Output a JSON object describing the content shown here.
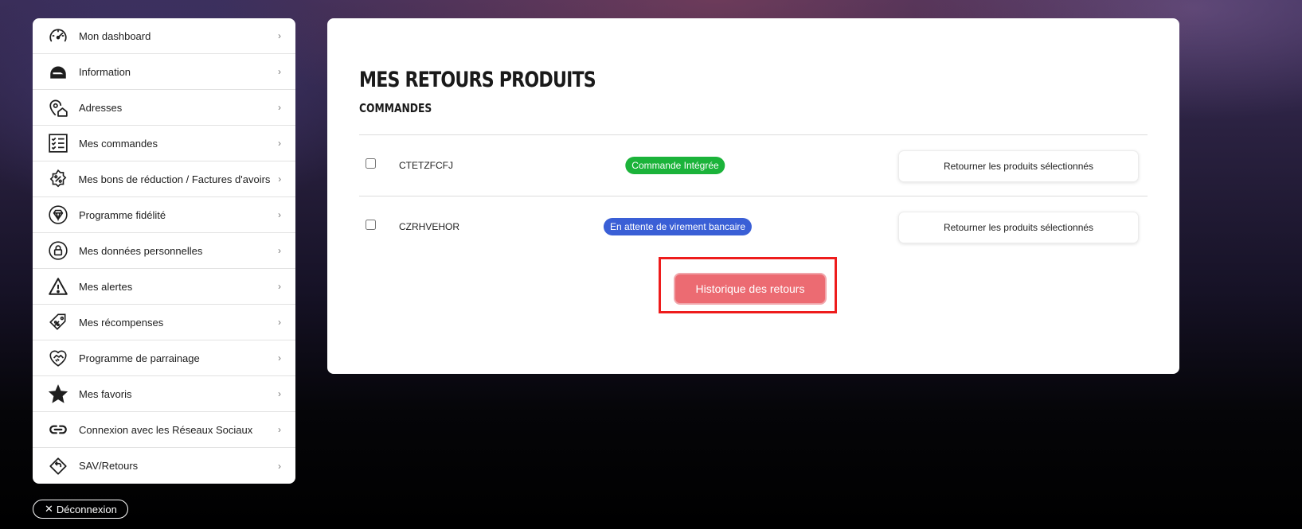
{
  "sidebar": {
    "items": [
      {
        "label": "Mon dashboard",
        "icon": "speedometer-icon"
      },
      {
        "label": "Information",
        "icon": "helmet-icon"
      },
      {
        "label": "Adresses",
        "icon": "location-home-icon"
      },
      {
        "label": "Mes commandes",
        "icon": "checklist-icon"
      },
      {
        "label": "Mes bons de réduction / Factures d'avoirs",
        "icon": "discount-badge-icon"
      },
      {
        "label": "Programme fidélité",
        "icon": "diamond-icon"
      },
      {
        "label": "Mes données personnelles",
        "icon": "lock-icon"
      },
      {
        "label": "Mes alertes",
        "icon": "warning-icon"
      },
      {
        "label": "Mes récompenses",
        "icon": "reward-tag-icon"
      },
      {
        "label": "Programme de parrainage",
        "icon": "handshake-heart-icon"
      },
      {
        "label": "Mes favoris",
        "icon": "star-icon"
      },
      {
        "label": "Connexion avec les Réseaux Sociaux",
        "icon": "link-icon"
      },
      {
        "label": "SAV/Retours",
        "icon": "return-icon"
      }
    ],
    "chevron": "›"
  },
  "logout": {
    "icon": "✕",
    "label": "Déconnexion"
  },
  "main": {
    "title": "MES RETOURS PRODUITS",
    "section_title": "COMMANDES",
    "orders": [
      {
        "ref": "CTETZFCFJ",
        "status": "Commande Intégrée",
        "status_color": "#1bb33a",
        "action": "Retourner les produits sélectionnés"
      },
      {
        "ref": "CZRHVEHOR",
        "status": "En attente de virement bancaire",
        "status_color": "#3a5fd6",
        "action": "Retourner les produits sélectionnés"
      }
    ],
    "history_button": "Historique des retours"
  },
  "colors": {
    "accent": "#ec6b72",
    "highlight": "#ee1c1c"
  }
}
